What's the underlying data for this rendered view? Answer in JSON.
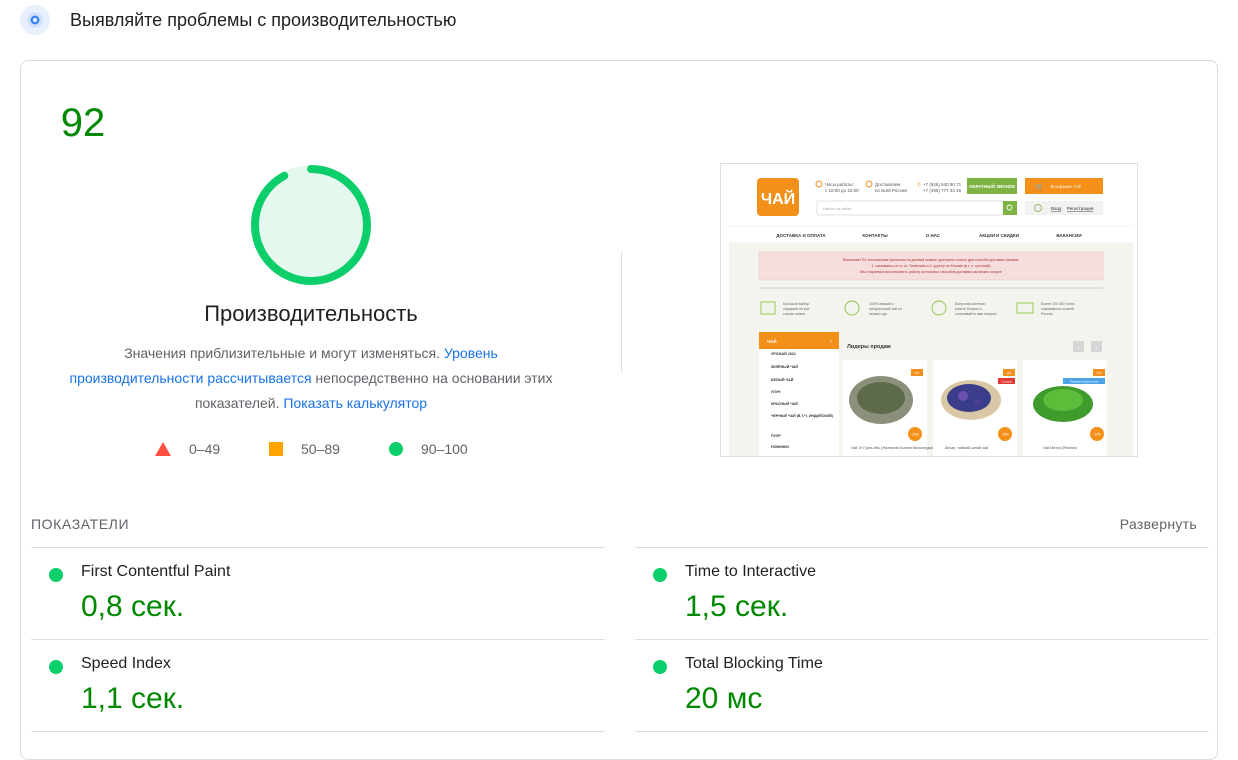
{
  "section": {
    "title": "Выявляйте проблемы с производительностью",
    "icon": "lighthouse-icon"
  },
  "performance": {
    "score": "92",
    "score_fraction": 0.92,
    "title": "Производительность",
    "desc_text_1": "Значения приблизительные и могут изменяться. ",
    "desc_link_1": "Уровень производительности рассчитывается",
    "desc_text_2": " непосредственно на основании этих показателей. ",
    "desc_link_2": "Показать калькулятор",
    "colors": {
      "pass": "#0cce6b",
      "average": "#ffa400",
      "fail": "#ff4e42",
      "pass_text": "#008800"
    }
  },
  "legend": [
    {
      "shape": "triangle",
      "label": "0–49"
    },
    {
      "shape": "square",
      "label": "50–89"
    },
    {
      "shape": "circle",
      "label": "90–100"
    }
  ],
  "screenshot": {
    "hours": "Часы работы:",
    "hours_value": "с 10:00 до 22:00",
    "delivery": "Доставляем",
    "delivery_value": "по всей России",
    "phone_1": "+7 (926) 540 90 71",
    "phone_2": "+7 (495) 777 34 16",
    "callback_button": "ОБРАТНЫЙ ЗВОНОК",
    "cart": "В корзине: 0 ₽",
    "search_placeholder": "Найти на сайте",
    "login": "Вход",
    "register": "Регистрация",
    "nav": [
      "ДОСТАВКА И ОПЛАТА",
      "КОНТАКТЫ",
      "О НАС",
      "АКЦИИ И СКИДКИ",
      "ВАКАНСИИ"
    ],
    "notice_1": "Внимание! По техническим причинам на данный момент доступны только два способа доставки заказов:",
    "notice_2": "1. самовывоз от ст. м. Таганская и 2. курьер по Москве (в т. ч. срочный)",
    "notice_3": "Мы стараемся восстановить работу остальных способов доставки как можно скорее",
    "features": [
      "Большой выбор подарков на все случаи жизни",
      "100% свежий и натуральный чай из первых рук",
      "Бонусная система: копите бонусы и оплачивайте ими покупки",
      "Более 200 000 точек самовывоза по всей России"
    ],
    "sidebar_title": "ЧАЙ",
    "sidebar_items": [
      "УРОЖАЙ 2022",
      "ЗЕЛЁНЫЙ ЧАЙ",
      "БЕЛЫЙ ЧАЙ",
      "УЛУН",
      "КРАСНЫЙ ЧАЙ",
      "ЧЕРНЫЙ ЧАЙ (В Т.Ч. ИНДИЙСКИЙ)",
      "ПУЭР",
      "НОВИНКИ"
    ],
    "leaders": "Лидеры продаж",
    "products": [
      {
        "name": "Чай Те Гуань Инь (Железная Богиня Милосердия) 1",
        "badge": "-25%",
        "tag": "HIT"
      },
      {
        "name": "Анчан, тайский синий чай",
        "badge": "-15%",
        "tag": "HIT",
        "extra": "Скидка"
      },
      {
        "name": "Чай Матча (Япония)",
        "badge": "-14%",
        "tag": "HIT",
        "extra": "Лучшая низкая цена"
      }
    ]
  },
  "metrics": {
    "label": "ПОКАЗАТЕЛИ",
    "expand": "Развернуть",
    "items": [
      {
        "name": "First Contentful Paint",
        "value": "0,8 сек.",
        "status": "pass"
      },
      {
        "name": "Time to Interactive",
        "value": "1,5 сек.",
        "status": "pass"
      },
      {
        "name": "Speed Index",
        "value": "1,1 сек.",
        "status": "pass"
      },
      {
        "name": "Total Blocking Time",
        "value": "20 мс",
        "status": "pass"
      }
    ]
  }
}
